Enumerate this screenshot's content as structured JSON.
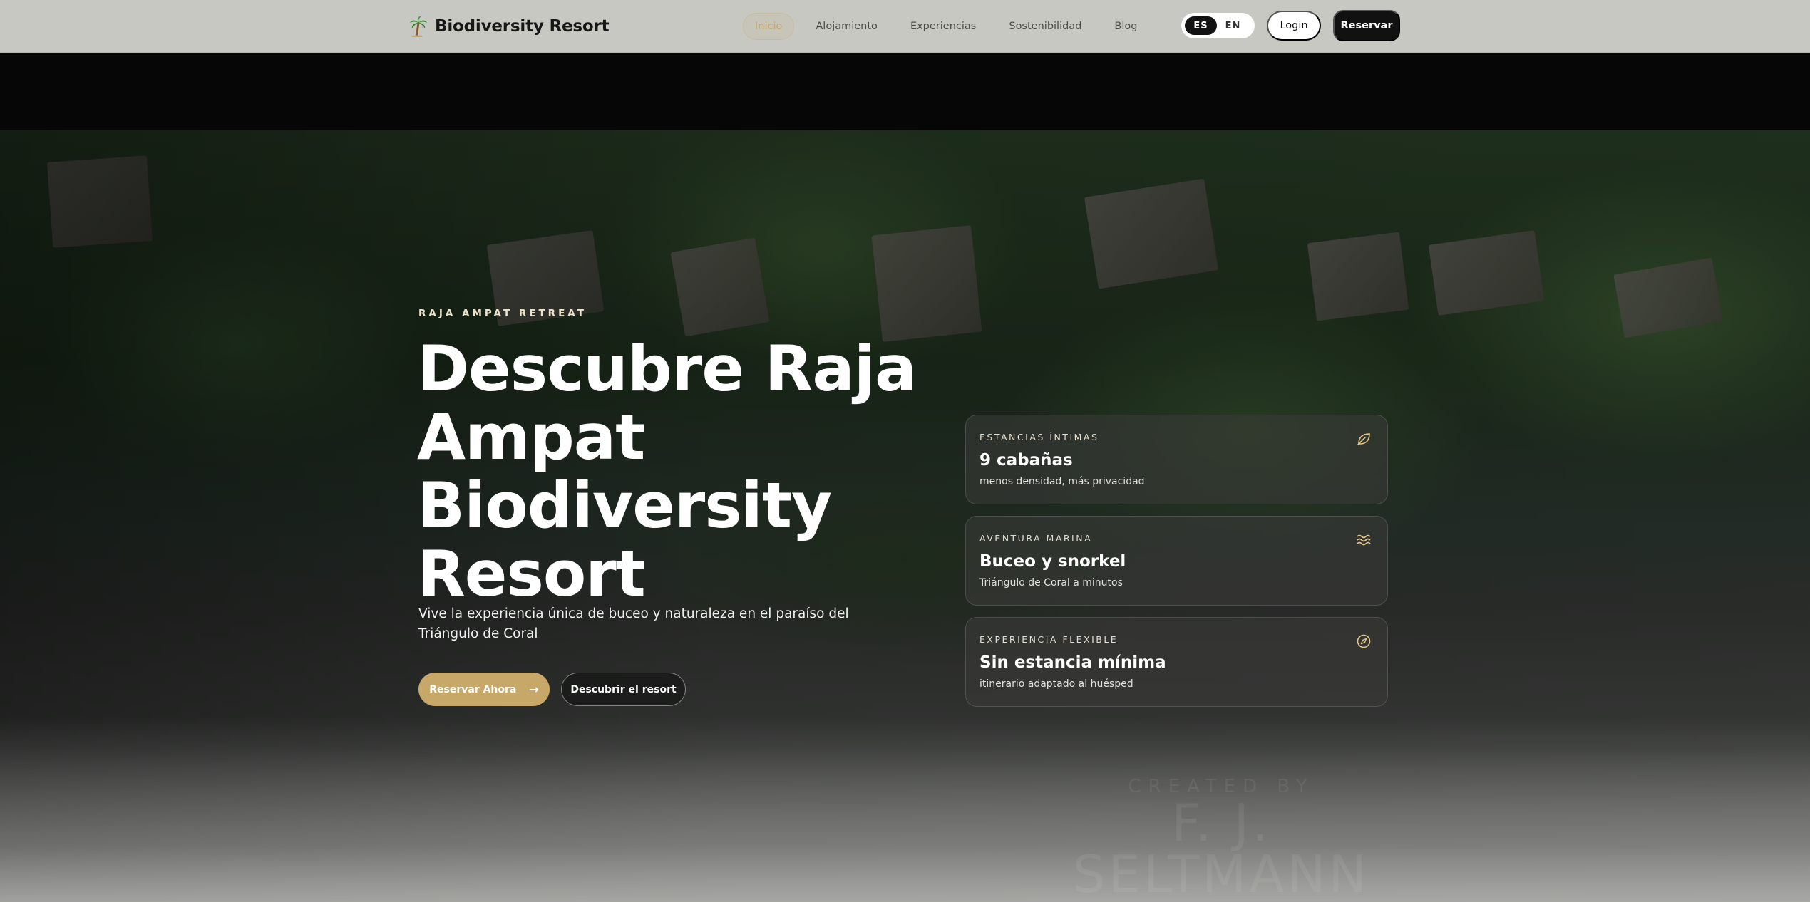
{
  "brand": {
    "name": "Biodiversity Resort",
    "icon": "palm-tree-icon"
  },
  "nav": {
    "links": [
      {
        "label": "Inicio",
        "active": true
      },
      {
        "label": "Alojamiento",
        "active": false
      },
      {
        "label": "Experiencias",
        "active": false
      },
      {
        "label": "Sostenibilidad",
        "active": false
      },
      {
        "label": "Blog",
        "active": false
      }
    ],
    "languages": [
      {
        "code": "ES",
        "selected": true
      },
      {
        "code": "EN",
        "selected": false
      }
    ],
    "login_label": "Login",
    "reserve_label": "Reservar"
  },
  "hero": {
    "eyebrow": "RAJA AMPAT RETREAT",
    "headline_lines": [
      "Descubre Raja",
      "Ampat",
      "Biodiversity",
      "Resort"
    ],
    "subtitle": "Vive la experiencia única de buceo y naturaleza en el paraíso del Triángulo de Coral",
    "primary_cta": "Reservar Ahora",
    "primary_cta_icon": "arrow-right-icon",
    "secondary_cta": "Descubrir el resort",
    "watermark_small": "CREATED BY",
    "watermark_large": "F. J. SELTMANN"
  },
  "cards": [
    {
      "label": "ESTANCIAS ÍNTIMAS",
      "title": "9 cabañas",
      "description": "menos densidad, más privacidad",
      "icon": "leaf-icon"
    },
    {
      "label": "AVENTURA MARINA",
      "title": "Buceo y snorkel",
      "description": "Triángulo de Coral a minutos",
      "icon": "waves-icon"
    },
    {
      "label": "EXPERIENCIA FLEXIBLE",
      "title": "Sin estancia mínima",
      "description": "itinerario adaptado al huésped",
      "icon": "compass-icon"
    }
  ],
  "colors": {
    "accent": "#c8a868",
    "nav_bg": "#c8c8c2",
    "dark": "#111111"
  }
}
